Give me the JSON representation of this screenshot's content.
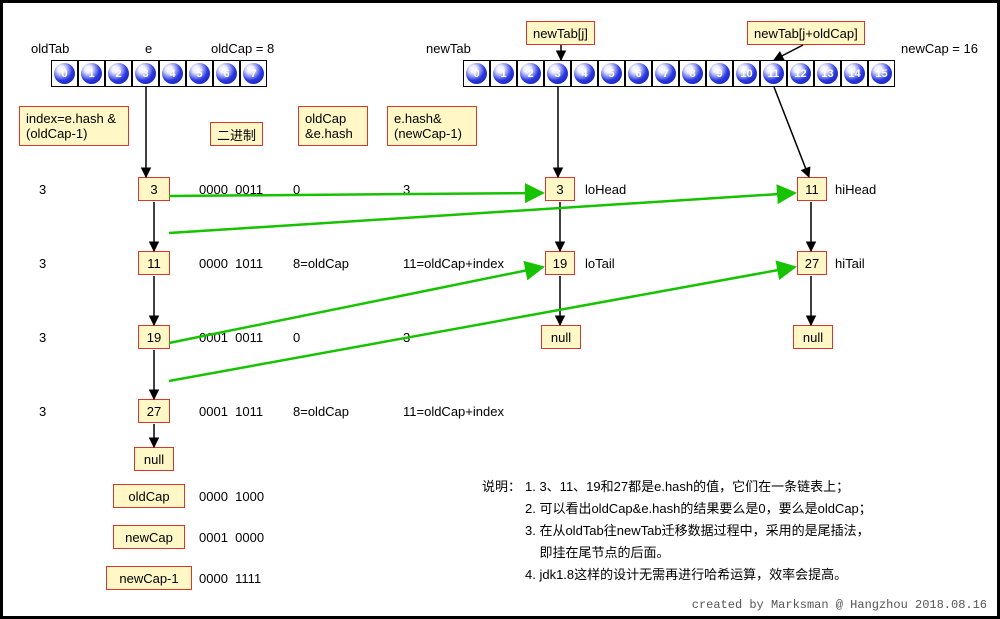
{
  "labels": {
    "oldTab": "oldTab",
    "e": "e",
    "oldCap": "oldCap = 8",
    "newTab": "newTab",
    "newTabJ": "newTab[j]",
    "newTabJOld": "newTab[j+oldCap]",
    "newCap": "newCap = 16",
    "indexExpr": "index=e.hash\n&(oldCap-1)",
    "binary": "二进制",
    "oldCapEHash": "oldCap\n&e.hash",
    "ehashNewCap": "e.hash&\n(newCap-1)",
    "loHead": "loHead",
    "loTail": "loTail",
    "hiHead": "hiHead",
    "hiTail": "hiTail",
    "oldCapBox": "oldCap",
    "newCapBox": "newCap",
    "newCapMinus1Box": "newCap-1"
  },
  "oldBuckets": [
    "0",
    "1",
    "2",
    "3",
    "4",
    "5",
    "6",
    "7"
  ],
  "newBuckets": [
    "0",
    "1",
    "2",
    "3",
    "4",
    "5",
    "6",
    "7",
    "8",
    "9",
    "10",
    "11",
    "12",
    "13",
    "14",
    "15"
  ],
  "chain": [
    {
      "idx": "3",
      "val": "3",
      "bin": "0000  0011",
      "ocr": "0",
      "nr": "3"
    },
    {
      "idx": "3",
      "val": "11",
      "bin": "0000  1011",
      "ocr": "8=oldCap",
      "nr": "11=oldCap+index"
    },
    {
      "idx": "3",
      "val": "19",
      "bin": "0001  0011",
      "ocr": "0",
      "nr": "3"
    },
    {
      "idx": "3",
      "val": "27",
      "bin": "0001  1011",
      "ocr": "8=oldCap",
      "nr": "11=oldCap+index"
    }
  ],
  "chainNull": "null",
  "loChain": {
    "v1": "3",
    "v2": "19",
    "end": "null"
  },
  "hiChain": {
    "v1": "11",
    "v2": "27",
    "end": "null"
  },
  "caps": {
    "oldCapBin": "0000  1000",
    "newCapBin": "0001  0000",
    "newCapM1Bin": "0000  1111"
  },
  "notesTitle": "说明：",
  "notes": [
    "1. 3、11、19和27都是e.hash的值，它们在一条链表上；",
    "2. 可以看出oldCap&e.hash的结果要么是0，要么是oldCap；",
    "3. 在从oldTab往newTab迁移数据过程中，采用的是尾插法，",
    "    即挂在尾节点的后面。",
    "4. jdk1.8这样的设计无需再进行哈希运算，效率会提高。"
  ],
  "footer": "created by Marksman @ Hangzhou 2018.08.16"
}
